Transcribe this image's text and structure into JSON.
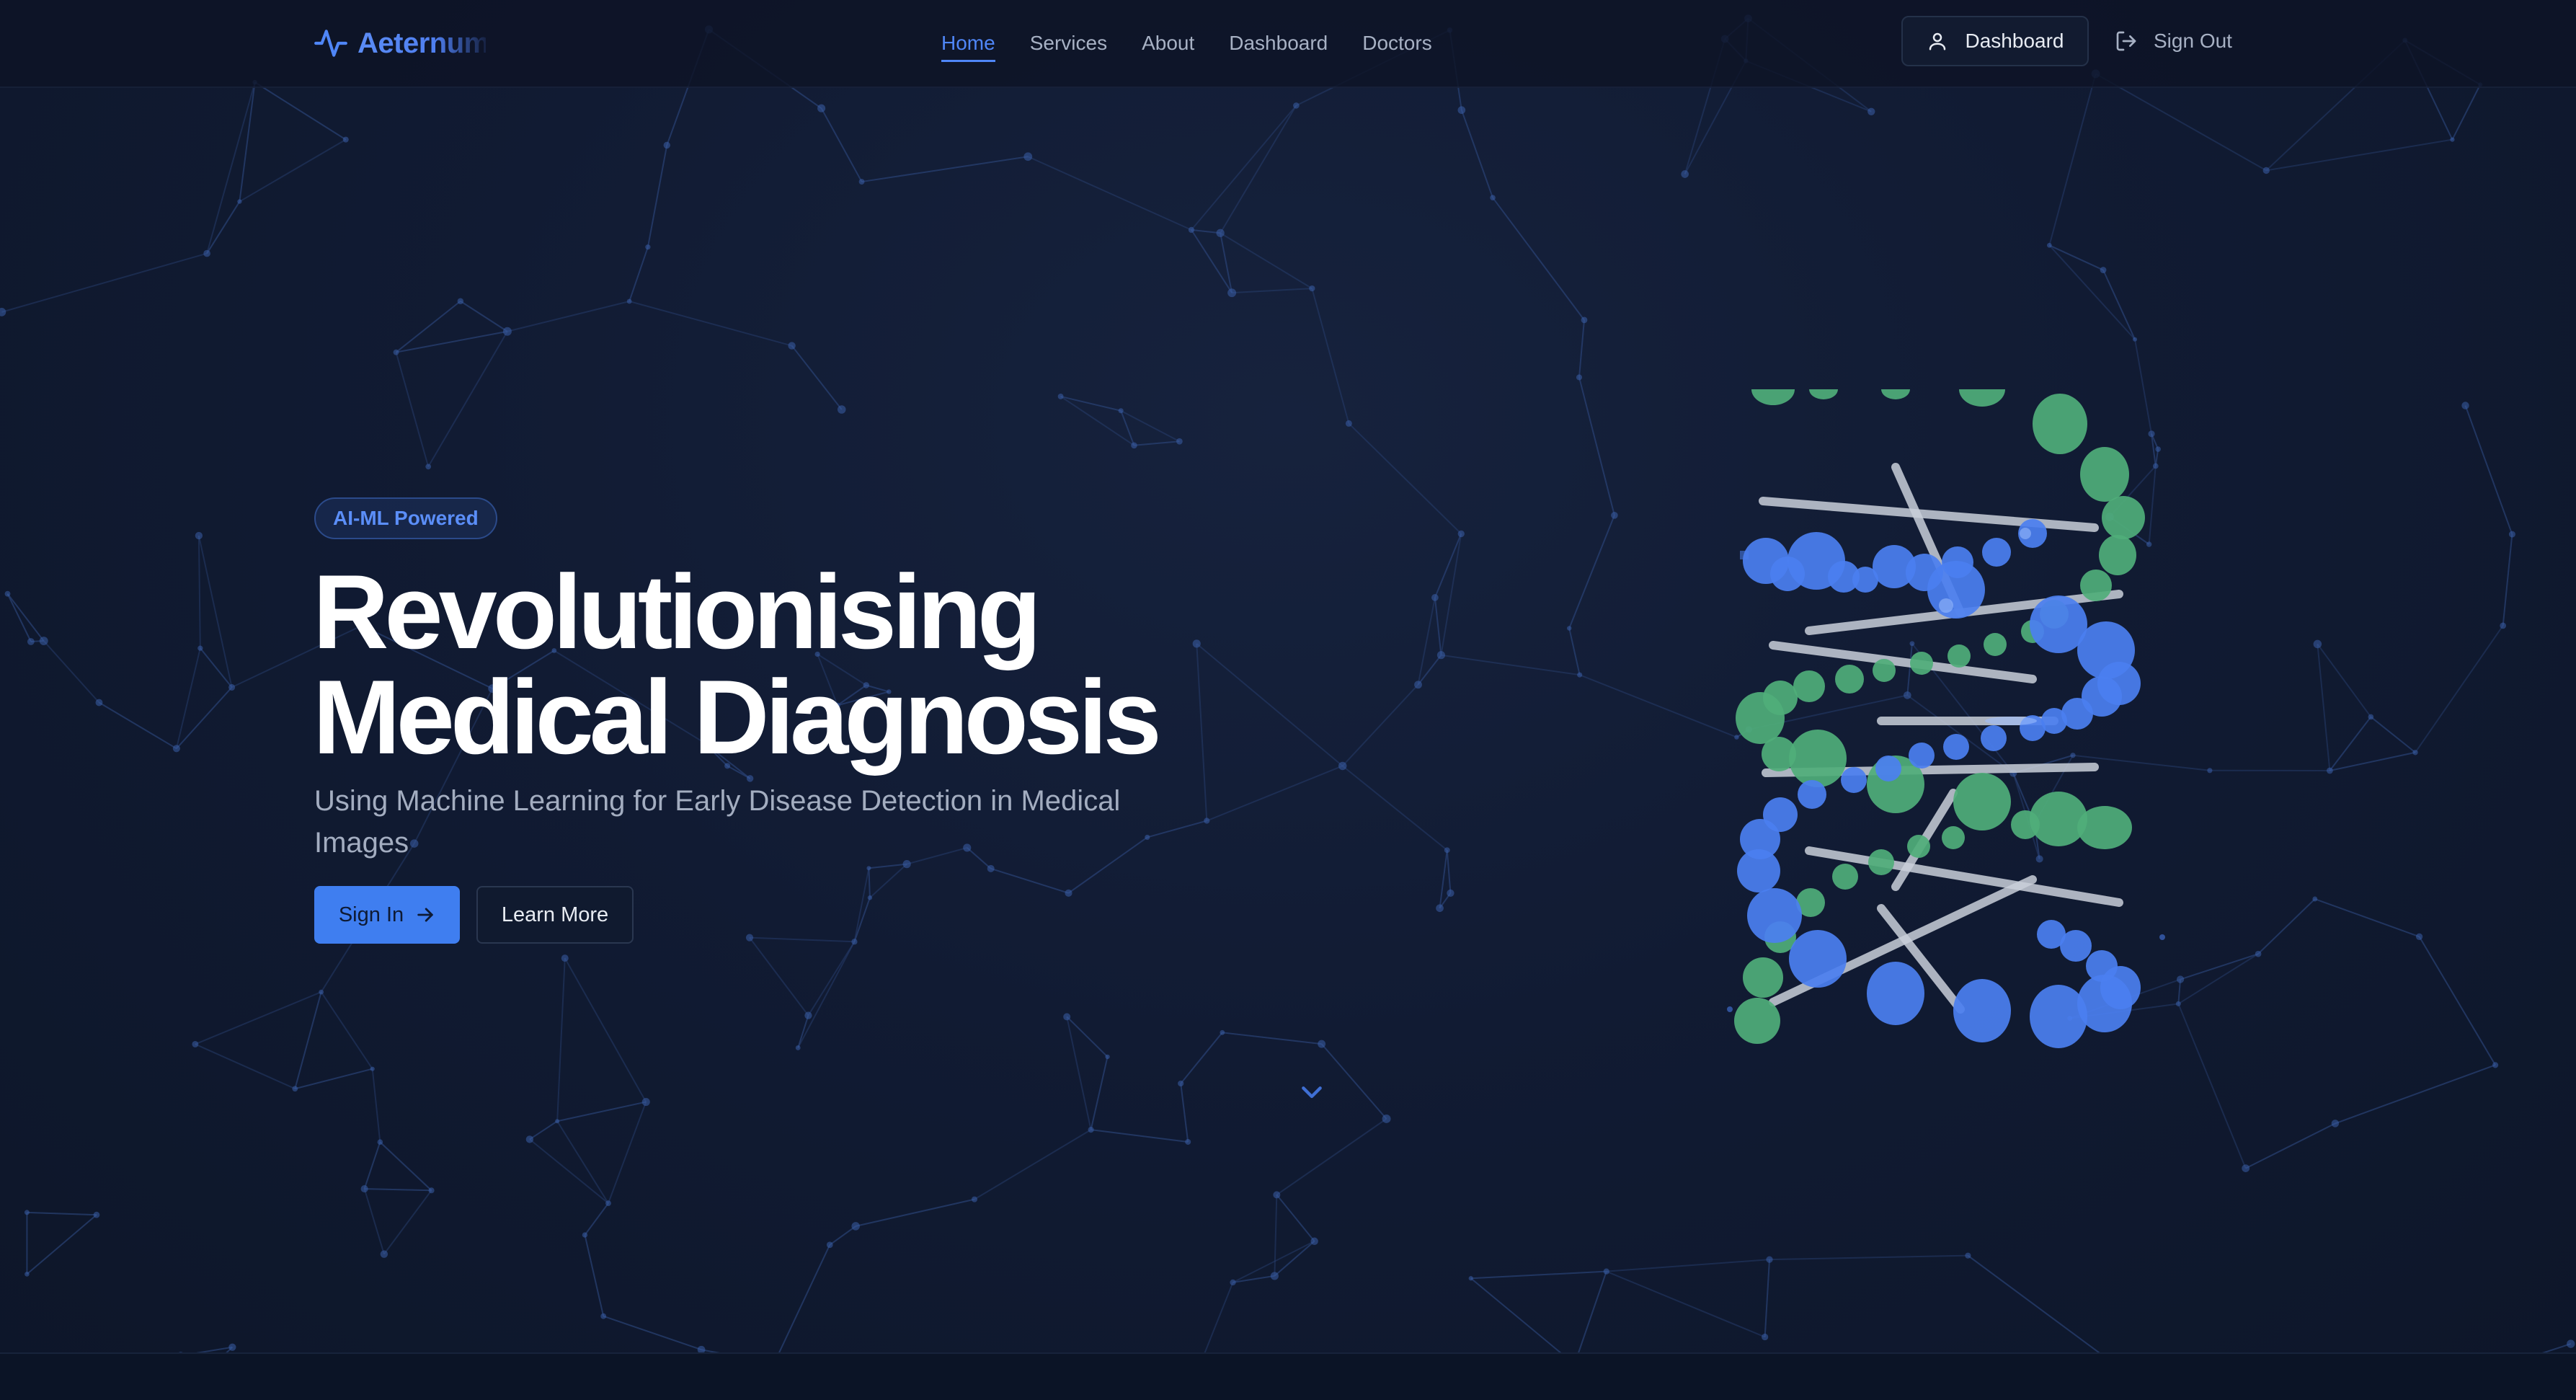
{
  "app": {
    "brand": "Aeternum",
    "logo_icon": "pulse-icon"
  },
  "nav": {
    "items": [
      {
        "label": "Home",
        "active": true
      },
      {
        "label": "Services",
        "active": false
      },
      {
        "label": "About",
        "active": false
      },
      {
        "label": "Dashboard",
        "active": false
      },
      {
        "label": "Doctors",
        "active": false
      }
    ]
  },
  "header_actions": {
    "dashboard_label": "Dashboard",
    "dashboard_icon": "user-icon",
    "signout_label": "Sign Out",
    "signout_icon": "logout-icon"
  },
  "hero": {
    "badge": "AI-ML Powered",
    "title_line1": "Revolutionising",
    "title_line2": "Medical Diagnosis",
    "subtitle": "Using Machine Learning for Early Disease Detection in Medical Images",
    "signin_label": "Sign In",
    "signin_icon": "arrow-right-icon",
    "learn_more_label": "Learn More",
    "scroll_icon": "chevron-down-icon",
    "illustration": "dna-helix"
  },
  "colors": {
    "accent": "#3f7ef0",
    "accent_text": "#5b8ef8",
    "background": "#111b33",
    "dna_green": "#4fae7a",
    "dna_blue": "#4b7ff0",
    "dna_rung": "#c9cfd9"
  }
}
